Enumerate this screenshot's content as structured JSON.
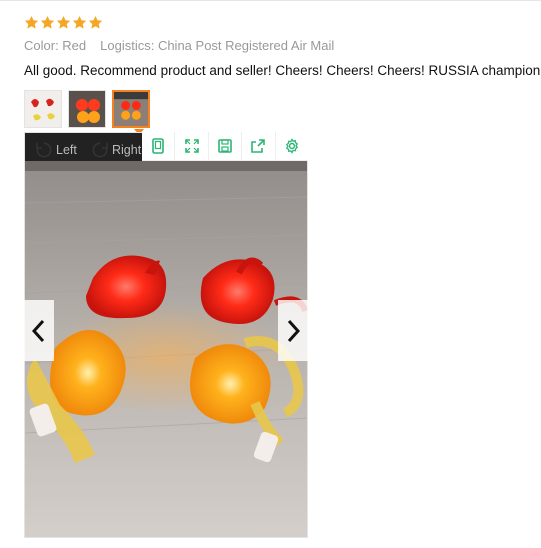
{
  "review": {
    "rating": 5,
    "rating_max": 5,
    "star_color": "#f5a623",
    "color_label": "Color: Red",
    "logistics_label": "Logistics: China Post Registered Air Mail",
    "text": "All good. Recommend product and seller! Cheers! Cheers! Cheers! RUSSIA champion!!!"
  },
  "gallery": {
    "thumbnail_count": 3,
    "selected_thumbnail": 3,
    "accent_color": "#f58220",
    "viewer": {
      "rotate_left_label": "Left",
      "rotate_right_label": "Right",
      "toolbar_icons": [
        "phone-view-icon",
        "fullscreen-icon",
        "save-icon",
        "share-icon",
        "settings-icon"
      ],
      "toolbar_icon_color": "#2bb673",
      "prev_icon": "chevron-left-icon",
      "next_icon": "chevron-right-icon"
    }
  }
}
